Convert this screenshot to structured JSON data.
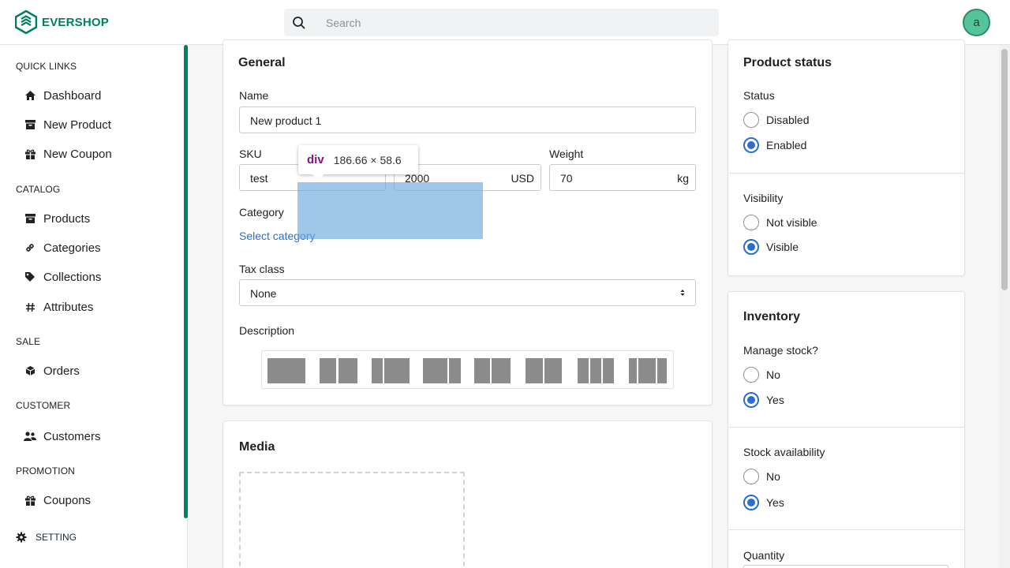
{
  "header": {
    "brand": "EVERSHOP",
    "search_placeholder": "Search",
    "avatar_letter": "a"
  },
  "sidebar": {
    "sections": {
      "quick_links": "QUICK LINKS",
      "catalog": "CATALOG",
      "sale": "SALE",
      "customer": "CUSTOMER",
      "promotion": "PROMOTION",
      "setting": "SETTING"
    },
    "items": {
      "dashboard": "Dashboard",
      "new_product": "New Product",
      "new_coupon": "New Coupon",
      "products": "Products",
      "categories": "Categories",
      "collections": "Collections",
      "attributes": "Attributes",
      "orders": "Orders",
      "customers": "Customers",
      "coupons": "Coupons"
    }
  },
  "general": {
    "title": "General",
    "name_label": "Name",
    "name_value": "New product 1",
    "sku_label": "SKU",
    "sku_value": "test",
    "price_value": "2000",
    "price_suffix": "USD",
    "weight_label": "Weight",
    "weight_value": "70",
    "weight_suffix": "kg",
    "category_label": "Category",
    "category_link": "Select category",
    "tax_label": "Tax class",
    "tax_value": "None",
    "description_label": "Description"
  },
  "media": {
    "title": "Media"
  },
  "product_status": {
    "title": "Product status",
    "status_label": "Status",
    "status_options": [
      "Disabled",
      "Enabled"
    ],
    "status_selected": "Enabled",
    "visibility_label": "Visibility",
    "visibility_options": [
      "Not visible",
      "Visible"
    ],
    "visibility_selected": "Visible"
  },
  "inventory": {
    "title": "Inventory",
    "manage_stock_label": "Manage stock?",
    "manage_stock_options": [
      "No",
      "Yes"
    ],
    "manage_stock_selected": "Yes",
    "stock_availability_label": "Stock availability",
    "stock_availability_options": [
      "No",
      "Yes"
    ],
    "stock_availability_selected": "Yes",
    "quantity_label": "Quantity"
  },
  "devtools_tooltip": {
    "tag": "div",
    "dimensions": "186.66 × 58.6"
  }
}
